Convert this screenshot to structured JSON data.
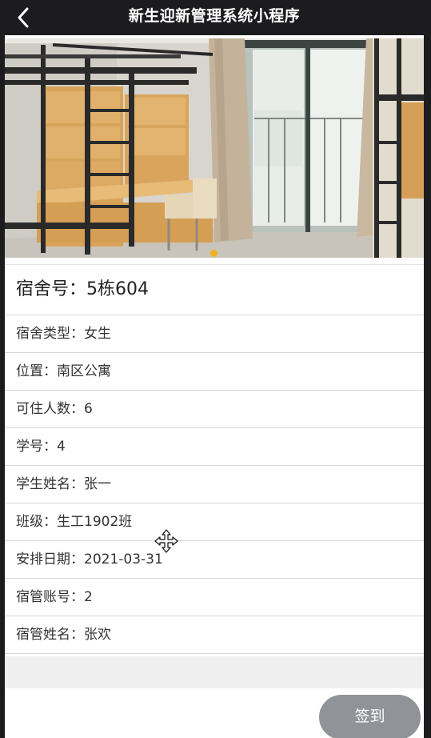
{
  "header": {
    "title": "新生迎新管理系统小程序",
    "back_icon": "chevron-left-icon"
  },
  "banner": {
    "slides": 1,
    "active_index": 0,
    "indicator_color": "#f3b21b"
  },
  "detail": {
    "dorm_no": "宿舍号：5栋604",
    "fields": [
      "宿舍类型：女生",
      "位置：南区公寓",
      "可住人数：6",
      "学号：4",
      "学生姓名：张一",
      "班级：生工1902班",
      "安排日期：2021-03-31",
      "宿管账号：2",
      "宿管姓名：张欢"
    ]
  },
  "actions": {
    "checkin_label": "签到"
  },
  "colors": {
    "navbar": "#1c1c1f",
    "button": "#909397",
    "divider": "#d6d6d6"
  }
}
